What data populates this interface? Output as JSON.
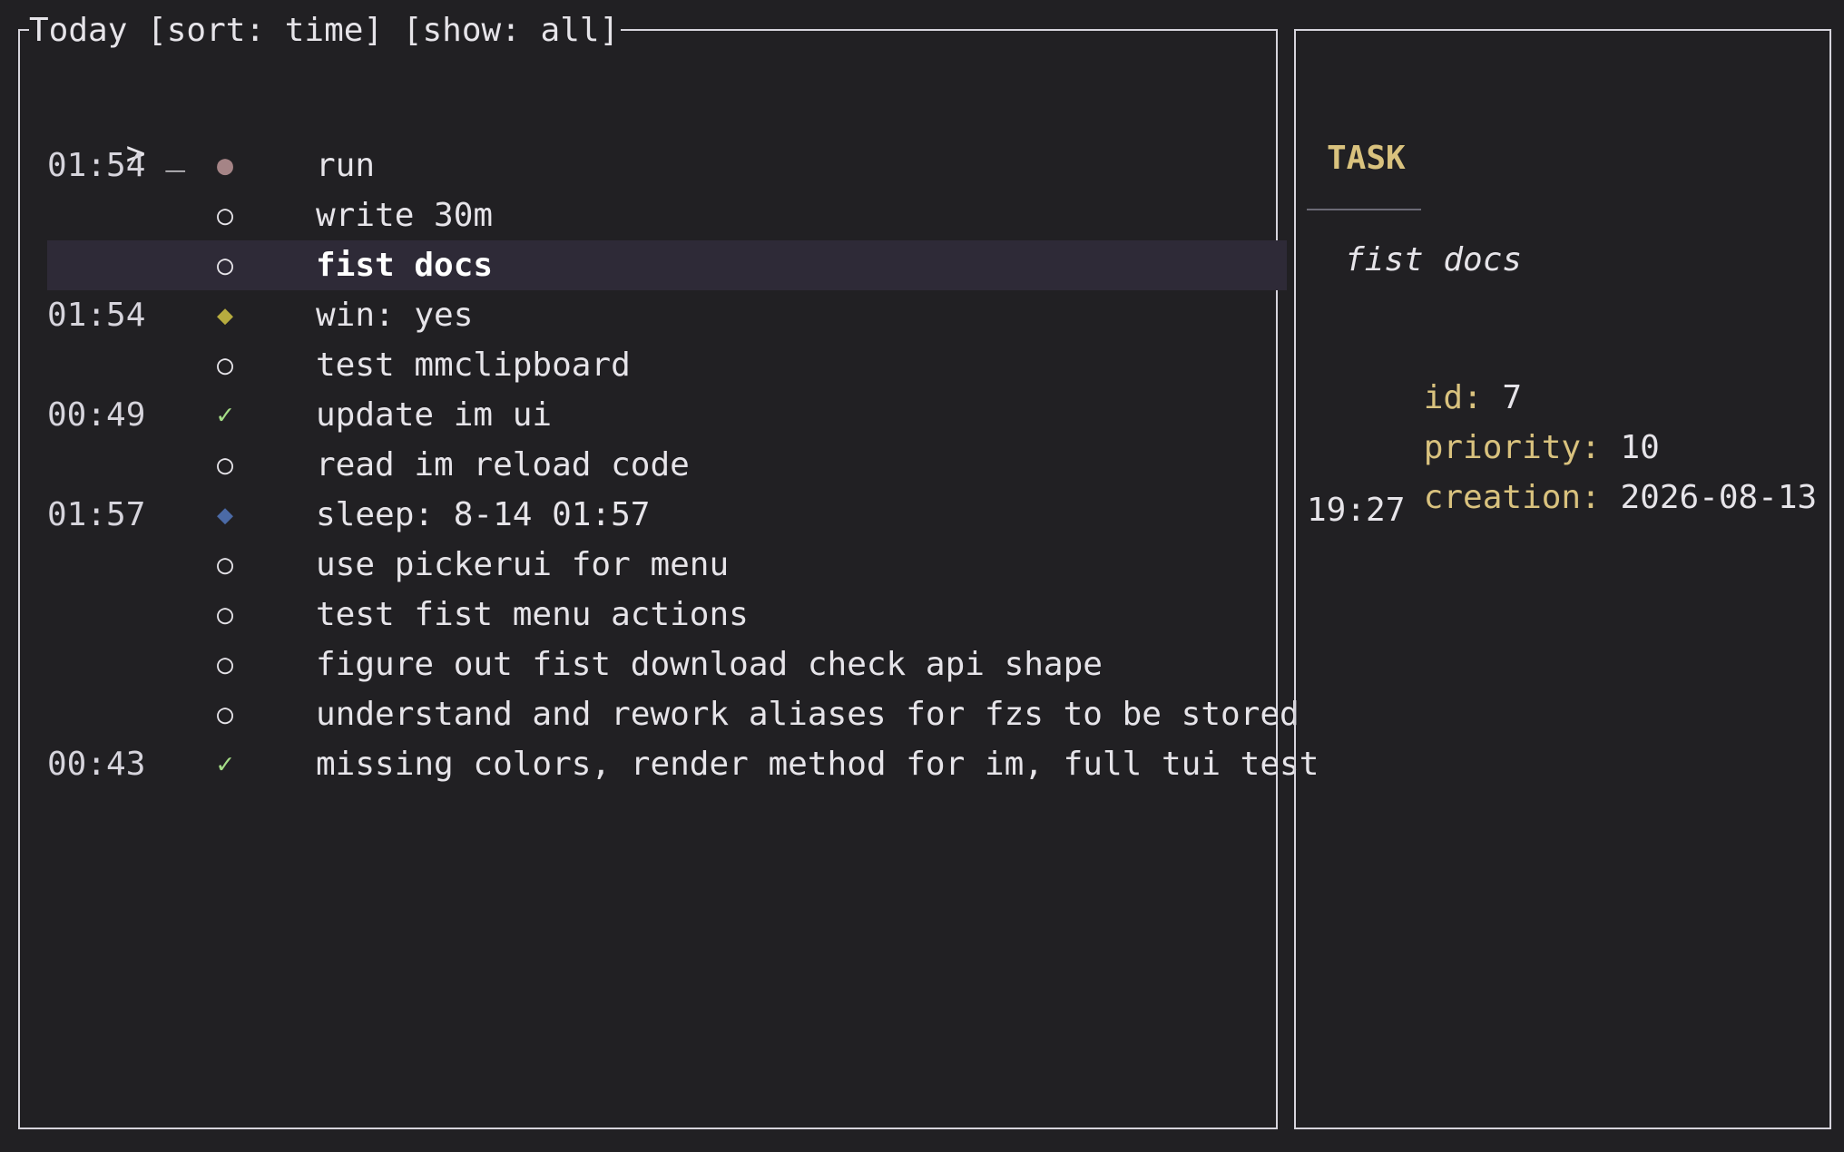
{
  "list_pane": {
    "title": "Today [sort: time] [show: all]",
    "prompt_symbol": ">",
    "prompt_cursor": "_",
    "tasks": [
      {
        "time": "01:54",
        "icon": "●",
        "icon_name": "filled-circle-icon",
        "icon_color": "#a58486",
        "text": "run",
        "selected": false
      },
      {
        "time": "",
        "icon": "○",
        "icon_name": "open-circle-icon",
        "icon_color": "#e6e4e9",
        "text": "write 30m",
        "selected": false
      },
      {
        "time": "",
        "icon": "○",
        "icon_name": "open-circle-icon",
        "icon_color": "#e6e4e9",
        "text": "fist docs",
        "selected": true
      },
      {
        "time": "01:54",
        "icon": "◆",
        "icon_name": "diamond-icon",
        "icon_color": "#b7ac3f",
        "text": "win: yes",
        "selected": false
      },
      {
        "time": "",
        "icon": "○",
        "icon_name": "open-circle-icon",
        "icon_color": "#e6e4e9",
        "text": "test mmclipboard",
        "selected": false
      },
      {
        "time": "00:49",
        "icon": "✓",
        "icon_name": "checkmark-icon",
        "icon_color": "#a4dc86",
        "text": "update im ui",
        "selected": false
      },
      {
        "time": "",
        "icon": "○",
        "icon_name": "open-circle-icon",
        "icon_color": "#e6e4e9",
        "text": "read im reload code",
        "selected": false
      },
      {
        "time": "01:57",
        "icon": "◆",
        "icon_name": "diamond-icon",
        "icon_color": "#4b6aa6",
        "text": "sleep: 8-14 01:57",
        "selected": false
      },
      {
        "time": "",
        "icon": "○",
        "icon_name": "open-circle-icon",
        "icon_color": "#e6e4e9",
        "text": "use pickerui for menu",
        "selected": false
      },
      {
        "time": "",
        "icon": "○",
        "icon_name": "open-circle-icon",
        "icon_color": "#e6e4e9",
        "text": "test fist menu actions",
        "selected": false
      },
      {
        "time": "",
        "icon": "○",
        "icon_name": "open-circle-icon",
        "icon_color": "#e6e4e9",
        "text": "figure out fist download check api shape",
        "selected": false
      },
      {
        "time": "",
        "icon": "○",
        "icon_name": "open-circle-icon",
        "icon_color": "#e6e4e9",
        "text": "understand and rework aliases for fzs to be stored",
        "selected": false
      },
      {
        "time": "00:43",
        "icon": "✓",
        "icon_name": "checkmark-icon",
        "icon_color": "#a4dc86",
        "text": "missing colors, render method for im, full tui test",
        "selected": false
      }
    ]
  },
  "detail_pane": {
    "heading": "TASK",
    "task_name": "fist docs",
    "fields": [
      {
        "key": "id:",
        "value": "7"
      },
      {
        "key": "priority:",
        "value": "10"
      },
      {
        "key": "creation:",
        "value": "2026-08-13"
      }
    ],
    "creation_wrap": "19:27"
  },
  "colors": {
    "background": "#212023",
    "border": "#d6d4dc",
    "selected_row": "#2e2a37",
    "accent_yellow": "#d9c27e"
  }
}
